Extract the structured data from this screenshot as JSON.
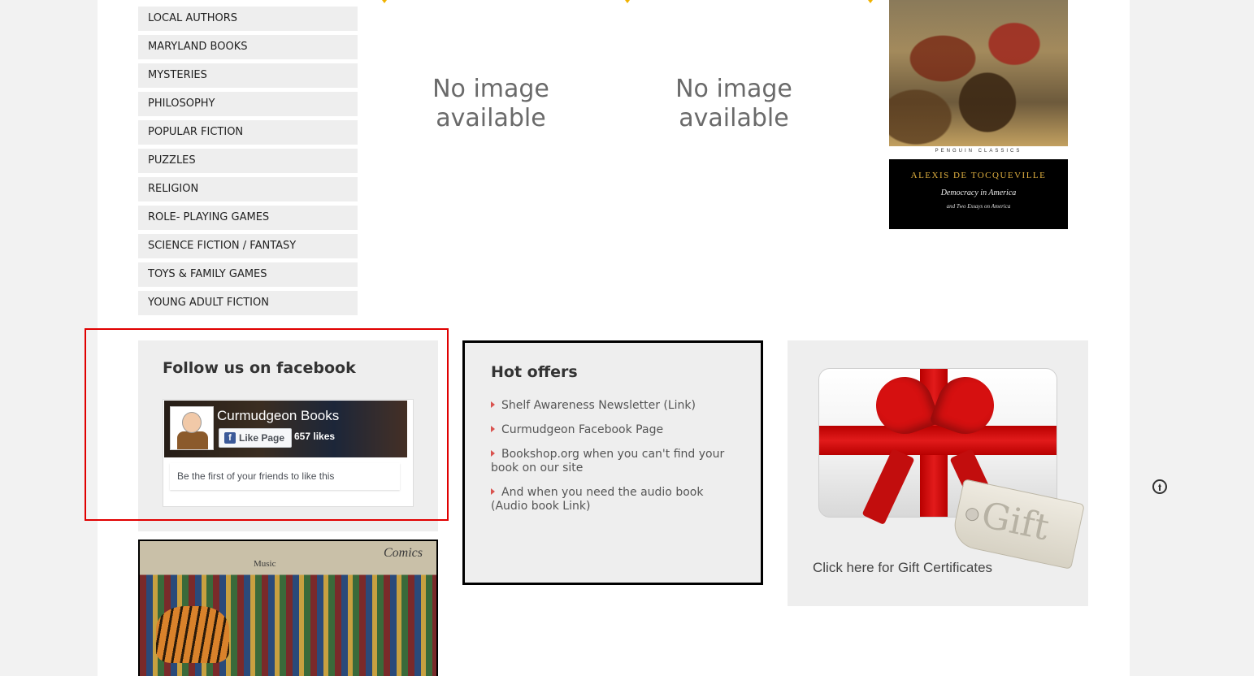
{
  "categories": [
    "LOCAL AUTHORS",
    "MARYLAND BOOKS",
    "MYSTERIES",
    "PHILOSOPHY",
    "POPULAR FICTION",
    "PUZZLES",
    "RELIGION",
    "ROLE- PLAYING GAMES",
    "SCIENCE FICTION / FANTASY",
    "TOYS & FAMILY GAMES",
    "YOUNG ADULT FICTION"
  ],
  "products": [
    {
      "image_text_line1": "No image",
      "image_text_line2": "available"
    },
    {
      "image_text_line1": "No image",
      "image_text_line2": "available"
    }
  ],
  "book_cover": {
    "publisher": "PENGUIN CLASSICS",
    "author": "ALEXIS DE TOCQUEVILLE",
    "title": "Democracy in America",
    "subtitle": "and Two Essays on America"
  },
  "facebook_widget": {
    "title": "Follow us on facebook",
    "page_name": "Curmudgeon Books",
    "like_button": "Like Page",
    "likes": "657 likes",
    "friends_text": "Be the first of your friends to like this"
  },
  "store_photo": {
    "sign_comics": "Comics",
    "sign_music": "Music"
  },
  "hot_offers": {
    "title": "Hot offers",
    "items": [
      "Shelf Awareness Newsletter (Link)",
      "Curmudgeon Facebook Page",
      "Bookshop.org when you can't find your book on our site",
      "And when you need the audio book (Audio book Link)"
    ]
  },
  "gift": {
    "tag_text": "Gift",
    "link_text": "Click here for Gift Certificates"
  },
  "colors": {
    "highlight": "#e00000",
    "bullet": "#d9534f",
    "facebook_blue": "#3b5998"
  },
  "icons": {
    "back_to_top": "arrow-up-circle-icon"
  }
}
